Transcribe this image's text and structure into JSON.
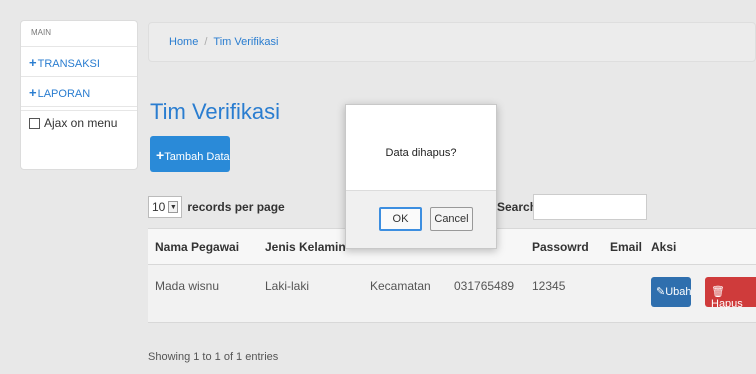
{
  "sidebar": {
    "header": "MAIN",
    "items": [
      {
        "label": "TRANSAKSI"
      },
      {
        "label": "LAPORAN"
      }
    ],
    "ajax_label": "Ajax on menu"
  },
  "breadcrumb": [
    "Home",
    "Tim Verifikasi"
  ],
  "page_title": "Tim Verifikasi",
  "add_button": "Tambah Data",
  "records": {
    "value": "10",
    "label": "records per page"
  },
  "search": {
    "label": "Search:",
    "value": ""
  },
  "table": {
    "headers": [
      "Nama Pegawai",
      "Jenis Kelamin",
      "",
      "",
      "Passowrd",
      "Email",
      "Aksi"
    ],
    "rows": [
      {
        "cells": [
          "Mada wisnu",
          "Laki-laki",
          "Kecamatan",
          "031765489",
          "12345",
          ""
        ]
      }
    ],
    "ubah_label": "Ubah",
    "hapus_label": "Hapus"
  },
  "info": "Showing 1 to 1 of 1 entries",
  "dialog": {
    "message": "Data dihapus?",
    "ok": "OK",
    "cancel": "Cancel"
  },
  "colors": {
    "accent": "#2a7dd0",
    "danger": "#cf3b3b",
    "primary_dark": "#2f6fae"
  }
}
